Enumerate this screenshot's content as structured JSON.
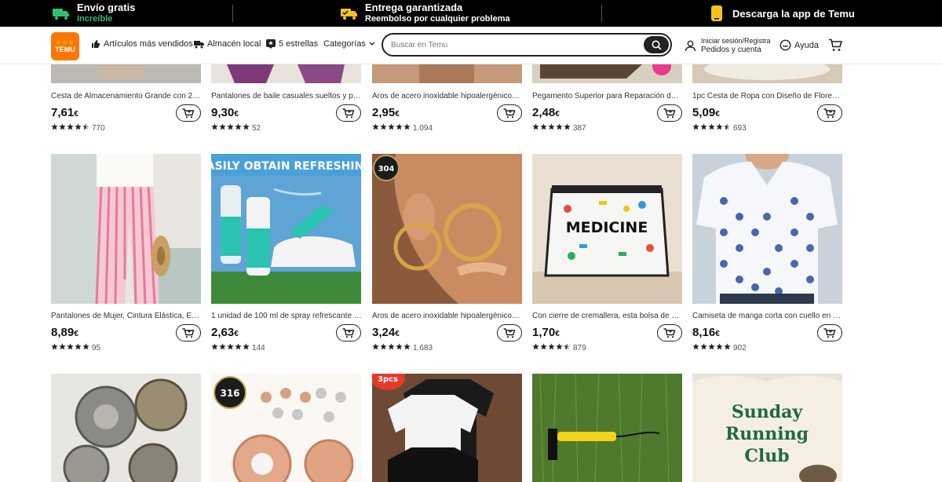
{
  "promo": {
    "shipping_title": "Envío gratis",
    "shipping_sub": "Increíble",
    "delivery_title": "Entrega garantizada",
    "delivery_sub": "Reembolso por cualquier problema",
    "app_text": "Descarga la app de Temu"
  },
  "header": {
    "logo_top": "🔶🔶🔶",
    "logo_text": "TEMU",
    "nav": [
      "Artículos más vendidos",
      "Almacén local",
      "5 estrellas",
      "Categorías"
    ],
    "search_placeholder": "Buscar en Temu",
    "account_line1": "Iniciar sesión/Registra",
    "account_line2": "Pedidos y cuenta",
    "help": "Ayuda"
  },
  "colors": {
    "accent": "#fb7701",
    "black": "#000000"
  },
  "products_row1": [
    {
      "name": "Cesta de Almacenamiento Grande con 24 ...",
      "price": "7,61",
      "currency": "€",
      "reviews": "770",
      "stars": 4.5
    },
    {
      "name": "Pantalones de baile casuales sueltos y pant...",
      "price": "9,30",
      "currency": "€",
      "reviews": "52",
      "stars": 5
    },
    {
      "name": "Aros de acero inoxidable hipoalergénicos c...",
      "price": "2,95",
      "currency": "€",
      "reviews": "1.094",
      "stars": 5
    },
    {
      "name": "Pegamento Superior para Reparación de Z...",
      "price": "2,48",
      "currency": "€",
      "reviews": "387",
      "stars": 5
    },
    {
      "name": "1pc Cesta de Ropa con Diseño de Flores y ...",
      "price": "5,09",
      "currency": "€",
      "reviews": "693",
      "stars": 4.5
    }
  ],
  "products_row2": [
    {
      "name": "Pantalones de Mujer, Cintura Elástica, Esta...",
      "price": "8,89",
      "currency": "€",
      "reviews": "95",
      "stars": 5
    },
    {
      "name": "1 unidad de 100 ml de spray refrescante p...",
      "price": "2,63",
      "currency": "€",
      "reviews": "144",
      "stars": 5
    },
    {
      "name": "Aros de acero inoxidable hipoalergénicos ...",
      "price": "3,24",
      "currency": "€",
      "reviews": "1.683",
      "stars": 5
    },
    {
      "name": "Con cierre de cremallera, esta bolsa de alm...",
      "price": "1,70",
      "currency": "€",
      "reviews": "879",
      "stars": 4.5
    },
    {
      "name": "Camiseta de manga corta con cuello en V, ...",
      "price": "8,16",
      "currency": "€",
      "reviews": "902",
      "stars": 5
    }
  ],
  "image_texts": {
    "spray_banner": "EASILY OBTAIN REFRESHING",
    "badge_304": "304",
    "medicine": "MEDICINE",
    "badge_316": "316",
    "pack": "3pcs",
    "shirt_line1": "Sunday",
    "shirt_line2": "Running",
    "shirt_line3": "Club"
  }
}
